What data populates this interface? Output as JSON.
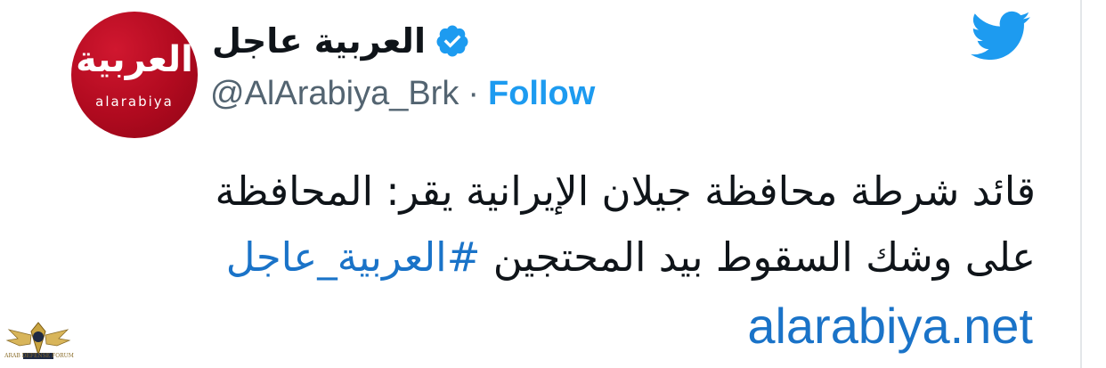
{
  "account": {
    "name": "العربية عاجل",
    "handle": "@AlArabiya_Brk",
    "separator": "·",
    "follow_label": "Follow",
    "verified": true,
    "avatar_logo_ar": "العربية",
    "avatar_logo_en": "alarabiya"
  },
  "tweet": {
    "line1": "قائد شرطة محافظة جيلان الإيرانية يقر: المحافظة",
    "line2_text": "على وشك السقوط بيد المحتجين ",
    "hashtag": "#العربية_عاجل",
    "link": "alarabiya.net"
  },
  "icons": {
    "brand": "twitter-bird-icon",
    "verified": "verified-badge-icon",
    "watermark": "forum-watermark-logo"
  },
  "colors": {
    "accent": "#1d9bf0",
    "link": "#1a73c8",
    "text": "#0f1419",
    "muted": "#536471",
    "avatar_red": "#c0102a"
  },
  "watermark_text": "ARAB DEFENSE FORUM"
}
